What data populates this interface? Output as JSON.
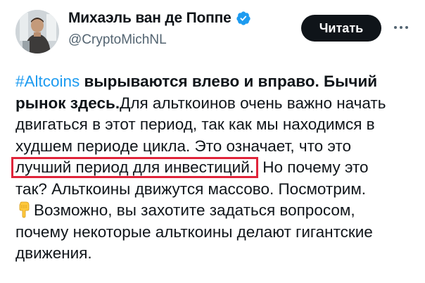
{
  "author": {
    "name": "Михаэль ван де Поппе",
    "handle": "@CryptoMichNL",
    "verified_icon": "verified-badge-icon",
    "verified_color": "#1d9bf0"
  },
  "actions": {
    "read_label": "Читать",
    "more_icon": "more-dots-icon"
  },
  "tweet": {
    "hashtag": "#Altcoins",
    "bold_1": " вырываются влево и вправо. Бычий",
    "bold_2": "рынок здесь.",
    "line_2_rest": "Для альткоинов очень важно начать",
    "line_3": "двигаться в этот период, так как мы находимся в",
    "line_4": "худшем периоде цикла.  Это означает, что это",
    "highlighted": "лучший период для инвестиций.",
    "line_5_rest": " Но почему это",
    "line_6": "так? Альткоины движутся массово.  Посмотрим.",
    "emoji_icon": "pointing-down-hand-icon",
    "line_7": "Возможно, вы захотите задаться вопросом,",
    "line_8": "почему некоторые альткоины делают гигантские",
    "line_9": "движения."
  },
  "colors": {
    "hashtag": "#1d9bf0",
    "highlight_border": "#e0243a",
    "button_bg": "#0f1419"
  }
}
